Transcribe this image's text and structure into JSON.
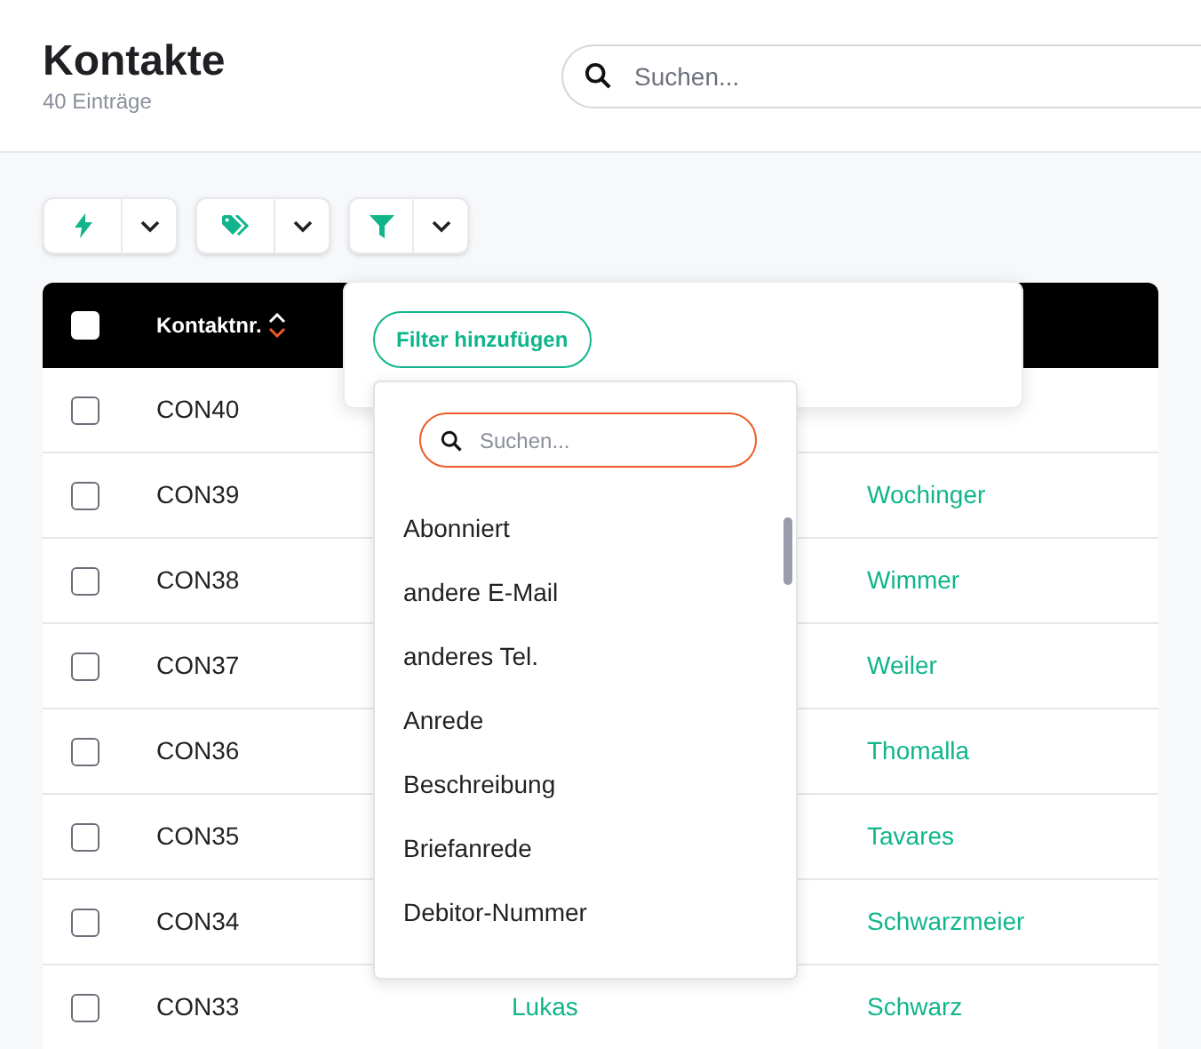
{
  "header": {
    "title": "Kontakte",
    "count": "40 Einträge",
    "search": {
      "placeholder": "Suchen..."
    }
  },
  "toolbar": [
    {
      "kind": "bolt"
    },
    {
      "kind": "tags"
    },
    {
      "kind": "filter"
    }
  ],
  "table": {
    "select_all": {
      "checked": false
    },
    "columns": [
      {
        "label": "Kontaktnr."
      }
    ],
    "rows": [
      {
        "id": "CON40",
        "checked": false
      },
      {
        "id": "CON39",
        "last_name": "Wochinger",
        "checked": false
      },
      {
        "id": "CON38",
        "last_name": "Wimmer",
        "checked": false
      },
      {
        "id": "CON37",
        "last_name": "Weiler",
        "checked": false
      },
      {
        "id": "CON36",
        "last_name": "Thomalla",
        "checked": false
      },
      {
        "id": "CON35",
        "last_name": "Tavares",
        "checked": false
      },
      {
        "id": "CON34",
        "last_name": "Schwarzmeier",
        "checked": false
      },
      {
        "id": "CON33",
        "first_name": "Lukas",
        "last_name": "Schwarz",
        "checked": false
      }
    ]
  },
  "filter_popup": {
    "button": "Filter hinzufügen",
    "dropdown": {
      "search": {
        "placeholder": "Suchen..."
      },
      "options": [
        "Abonniert",
        "andere E-Mail",
        "anderes Tel.",
        "Anrede",
        "Beschreibung",
        "Briefanrede",
        "Debitor-Nummer"
      ]
    }
  }
}
